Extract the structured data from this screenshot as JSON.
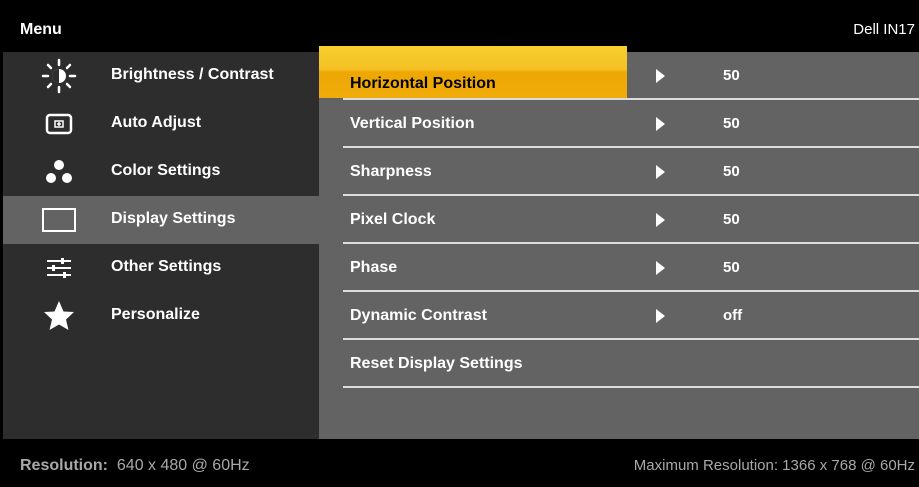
{
  "header": {
    "menu_title": "Menu",
    "model": "Dell IN17"
  },
  "sidebar": {
    "items": [
      {
        "label": "Brightness / Contrast",
        "icon": "brightness-icon"
      },
      {
        "label": "Auto Adjust",
        "icon": "auto-adjust-icon"
      },
      {
        "label": "Color Settings",
        "icon": "color-settings-icon"
      },
      {
        "label": "Display Settings",
        "icon": "display-settings-icon",
        "selected": true
      },
      {
        "label": "Other Settings",
        "icon": "sliders-icon"
      },
      {
        "label": "Personalize",
        "icon": "star-icon"
      }
    ]
  },
  "settings": {
    "rows": [
      {
        "label": "Horizontal Position",
        "value": "50",
        "highlighted": true
      },
      {
        "label": "Vertical Position",
        "value": "50"
      },
      {
        "label": "Sharpness",
        "value": "50"
      },
      {
        "label": "Pixel Clock",
        "value": "50"
      },
      {
        "label": "Phase",
        "value": "50"
      },
      {
        "label": "Dynamic Contrast",
        "value": "off"
      },
      {
        "label": "Reset Display Settings"
      }
    ]
  },
  "footer": {
    "resolution_label": "Resolution:",
    "resolution_value": "640 x 480 @ 60Hz",
    "max_resolution": "Maximum Resolution: 1366 x 768 @ 60Hz"
  },
  "colors": {
    "highlight": "#f0ac0a",
    "sidebar_bg": "#2d2d2d",
    "panel_bg": "#636363"
  }
}
